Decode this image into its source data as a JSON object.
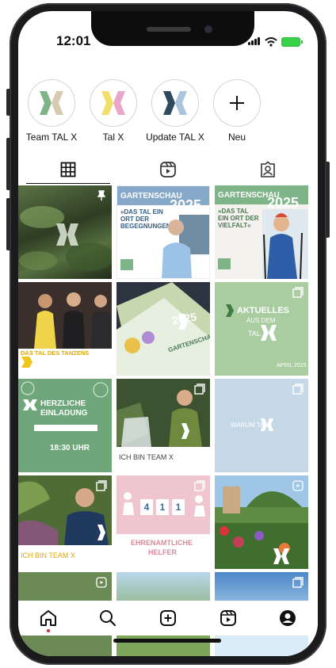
{
  "status_bar": {
    "time": "12:01"
  },
  "colors": {
    "brand_green": "#7fb489",
    "brand_blue": "#2f4a5c",
    "accent_dot": "#e0243a"
  },
  "highlights": [
    {
      "label": "Team TAL X",
      "icon": "talx-logo-icon"
    },
    {
      "label": "Tal X",
      "icon": "talx-logo-icon"
    },
    {
      "label": "Update TAL X",
      "icon": "talx-logo-icon"
    },
    {
      "label": "Neu",
      "icon": "plus-icon"
    }
  ],
  "tabs": [
    {
      "name": "grid",
      "icon": "grid-icon"
    },
    {
      "name": "reels",
      "icon": "reels-icon"
    },
    {
      "name": "tagged",
      "icon": "tagged-icon"
    }
  ],
  "posts": {
    "p2": {
      "title": "GARTENSCHAU",
      "year": "2025",
      "tagline": "»DAS TAL EIN ORT DER BEGEGNUNGEN«"
    },
    "p3": {
      "title": "GARTENSCHAU",
      "year": "2025",
      "tagline": "»DAS TAL EIN ORT DER VIELFALT«"
    },
    "p4": {
      "title": "DAS TAL DES TANZENS"
    },
    "p5": {
      "year": "2025",
      "title": "GARTENSCHAU"
    },
    "p6": {
      "line1": "AKTUELLES",
      "line2": "AUS DEM",
      "line3": "TAL",
      "date": "APRIL 2025"
    },
    "p7": {
      "line1": "HERZLICHE",
      "line2": "EINLADUNG",
      "time": "18:30 UHR"
    },
    "p8": {
      "caption": "ICH BIN TEAM X"
    },
    "p9": {
      "caption": "WARUM TAL"
    },
    "p10": {
      "caption": "ICH BIN TEAM X"
    },
    "p11": {
      "digits": [
        "4",
        "1",
        "1"
      ],
      "line1": "EHRENAMTLICHE",
      "line2": "HELFER"
    }
  },
  "bottom_nav": [
    {
      "name": "home",
      "icon": "home-icon"
    },
    {
      "name": "search",
      "icon": "search-icon"
    },
    {
      "name": "create",
      "icon": "add-post-icon"
    },
    {
      "name": "reels",
      "icon": "reels-icon"
    },
    {
      "name": "profile",
      "icon": "profile-icon"
    }
  ]
}
